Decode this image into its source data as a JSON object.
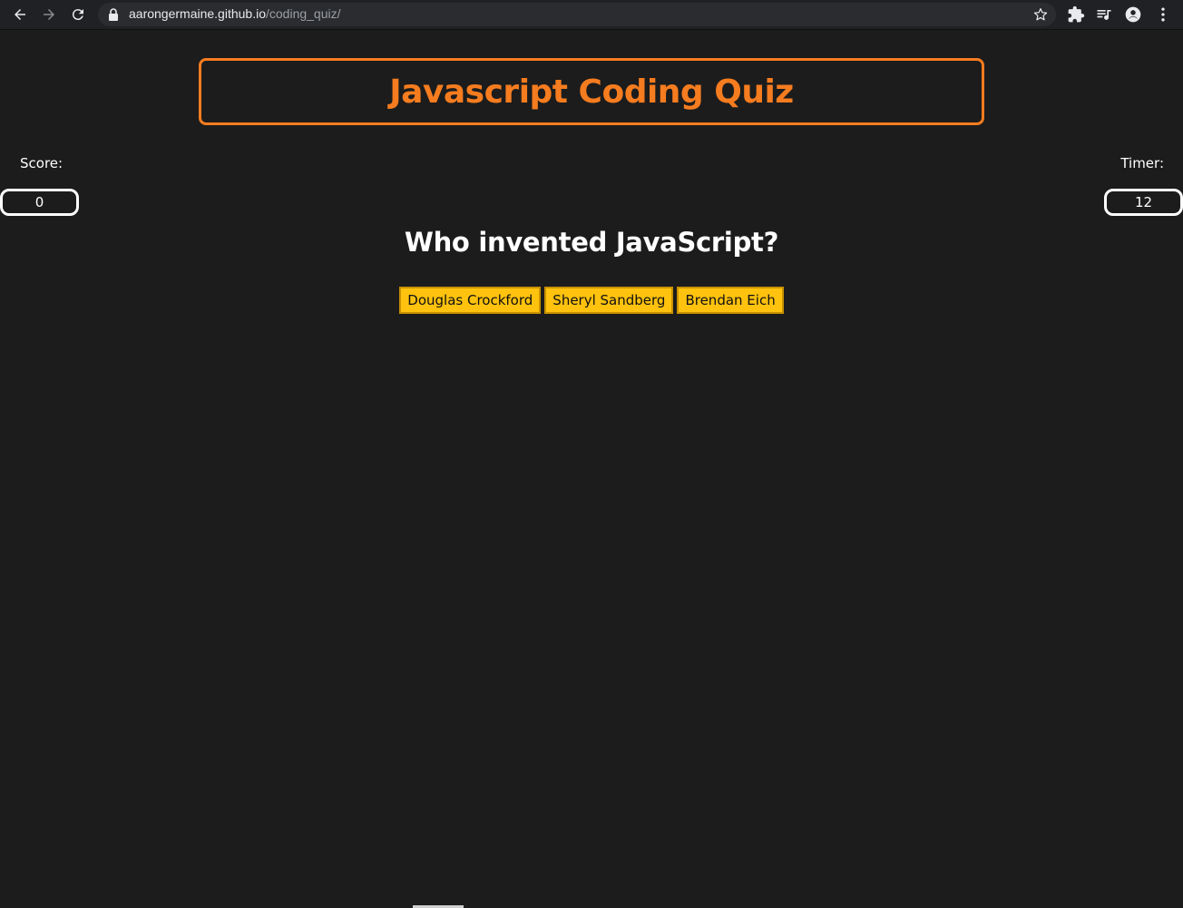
{
  "browser": {
    "url_host": "aarongermaine.github.io",
    "url_path": "/coding_quiz/",
    "icons": [
      "back-arrow-icon",
      "forward-arrow-icon",
      "reload-icon",
      "lock-icon",
      "star-icon",
      "extensions-icon",
      "media-queue-icon",
      "account-icon",
      "menu-dots-icon"
    ]
  },
  "quiz": {
    "title": "Javascript Coding Quiz",
    "score_label": "Score:",
    "score_value": "0",
    "timer_label": "Timer:",
    "timer_value": "12",
    "question": "Who invented JavaScript?",
    "answers": [
      "Douglas Crockford",
      "Sheryl Sandberg",
      "Brendan Eich"
    ]
  },
  "colors": {
    "background": "#1c1c1c",
    "accent_orange": "#f57c1f",
    "answer_yellow": "#ffc20e",
    "text": "#ffffff"
  }
}
